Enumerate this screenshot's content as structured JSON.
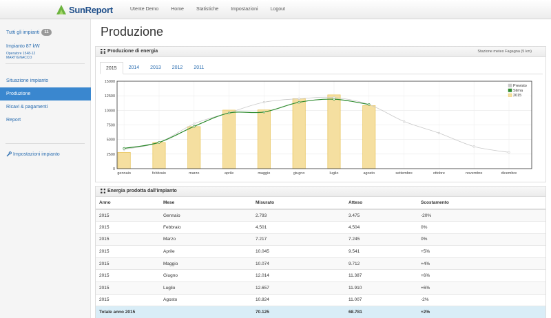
{
  "app": {
    "logo_text": "SunReport"
  },
  "nav": [
    "Utente Demo",
    "Home",
    "Statistiche",
    "Impostazioni",
    "Logout"
  ],
  "sidebar": {
    "all_plants": "Tutti gli impianti",
    "all_plants_count": "11",
    "plant_name": "Impianto 87 kW",
    "plant_sub1": "Operatore 1548-12",
    "plant_sub2": "MARTIGNACCO",
    "items": [
      "Situazione impianto",
      "Produzione",
      "Ricavi & pagamenti",
      "Report"
    ],
    "active_index": 1,
    "settings": "Impostazioni impianto"
  },
  "page_title": "Produzione",
  "chart_panel": {
    "title": "Produzione di energia",
    "station": "Stazione meteo Fagagna (5 km)",
    "tabs": [
      "2015",
      "2014",
      "2013",
      "2012",
      "2011"
    ],
    "active_tab": 0
  },
  "chart_data": {
    "type": "bar",
    "categories": [
      "gennaio",
      "febbraio",
      "marzo",
      "aprile",
      "maggio",
      "giugno",
      "luglio",
      "agosto",
      "settembre",
      "ottobre",
      "novembre",
      "dicembre"
    ],
    "ylim": [
      0,
      15000
    ],
    "yticks": [
      0,
      2500,
      5000,
      7500,
      10000,
      12500,
      15000
    ],
    "grid": true,
    "legend_position": "top-right",
    "series": [
      {
        "name": "Previsto",
        "type": "line",
        "color": "#c8c8c8",
        "values": [
          3300,
          4500,
          7700,
          9600,
          11400,
          12000,
          12200,
          11000,
          8100,
          6100,
          3800,
          2800
        ]
      },
      {
        "name": "Stima",
        "type": "line",
        "color": "#2e8b2e",
        "values": [
          3475,
          4504,
          7245,
          9541,
          9712,
          11387,
          11910,
          11007,
          null,
          null,
          null,
          null
        ]
      },
      {
        "name": "2015",
        "type": "bar",
        "color": "#f5dfa0",
        "stroke": "#e8c45a",
        "values": [
          2793,
          4501,
          7217,
          10045,
          10074,
          12014,
          12657,
          10824,
          null,
          null,
          null,
          null
        ]
      }
    ]
  },
  "table_panel": {
    "title": "Energia prodotta dall'impianto",
    "headers": [
      "Anno",
      "Mese",
      "Misurato",
      "Atteso",
      "Scostamento"
    ],
    "rows": [
      [
        "2015",
        "Gennaio",
        "2.793",
        "3.475",
        "-20%"
      ],
      [
        "2015",
        "Febbraio",
        "4.501",
        "4.504",
        "0%"
      ],
      [
        "2015",
        "Marzo",
        "7.217",
        "7.245",
        "0%"
      ],
      [
        "2015",
        "Aprile",
        "10.045",
        "9.541",
        "+5%"
      ],
      [
        "2015",
        "Maggio",
        "10.074",
        "9.712",
        "+4%"
      ],
      [
        "2015",
        "Giugno",
        "12.014",
        "11.387",
        "+6%"
      ],
      [
        "2015",
        "Luglio",
        "12.657",
        "11.910",
        "+6%"
      ],
      [
        "2015",
        "Agosto",
        "10.824",
        "11.007",
        "-2%"
      ]
    ],
    "total": [
      "Totale anno 2015",
      "",
      "70.125",
      "68.781",
      "+2%"
    ]
  }
}
